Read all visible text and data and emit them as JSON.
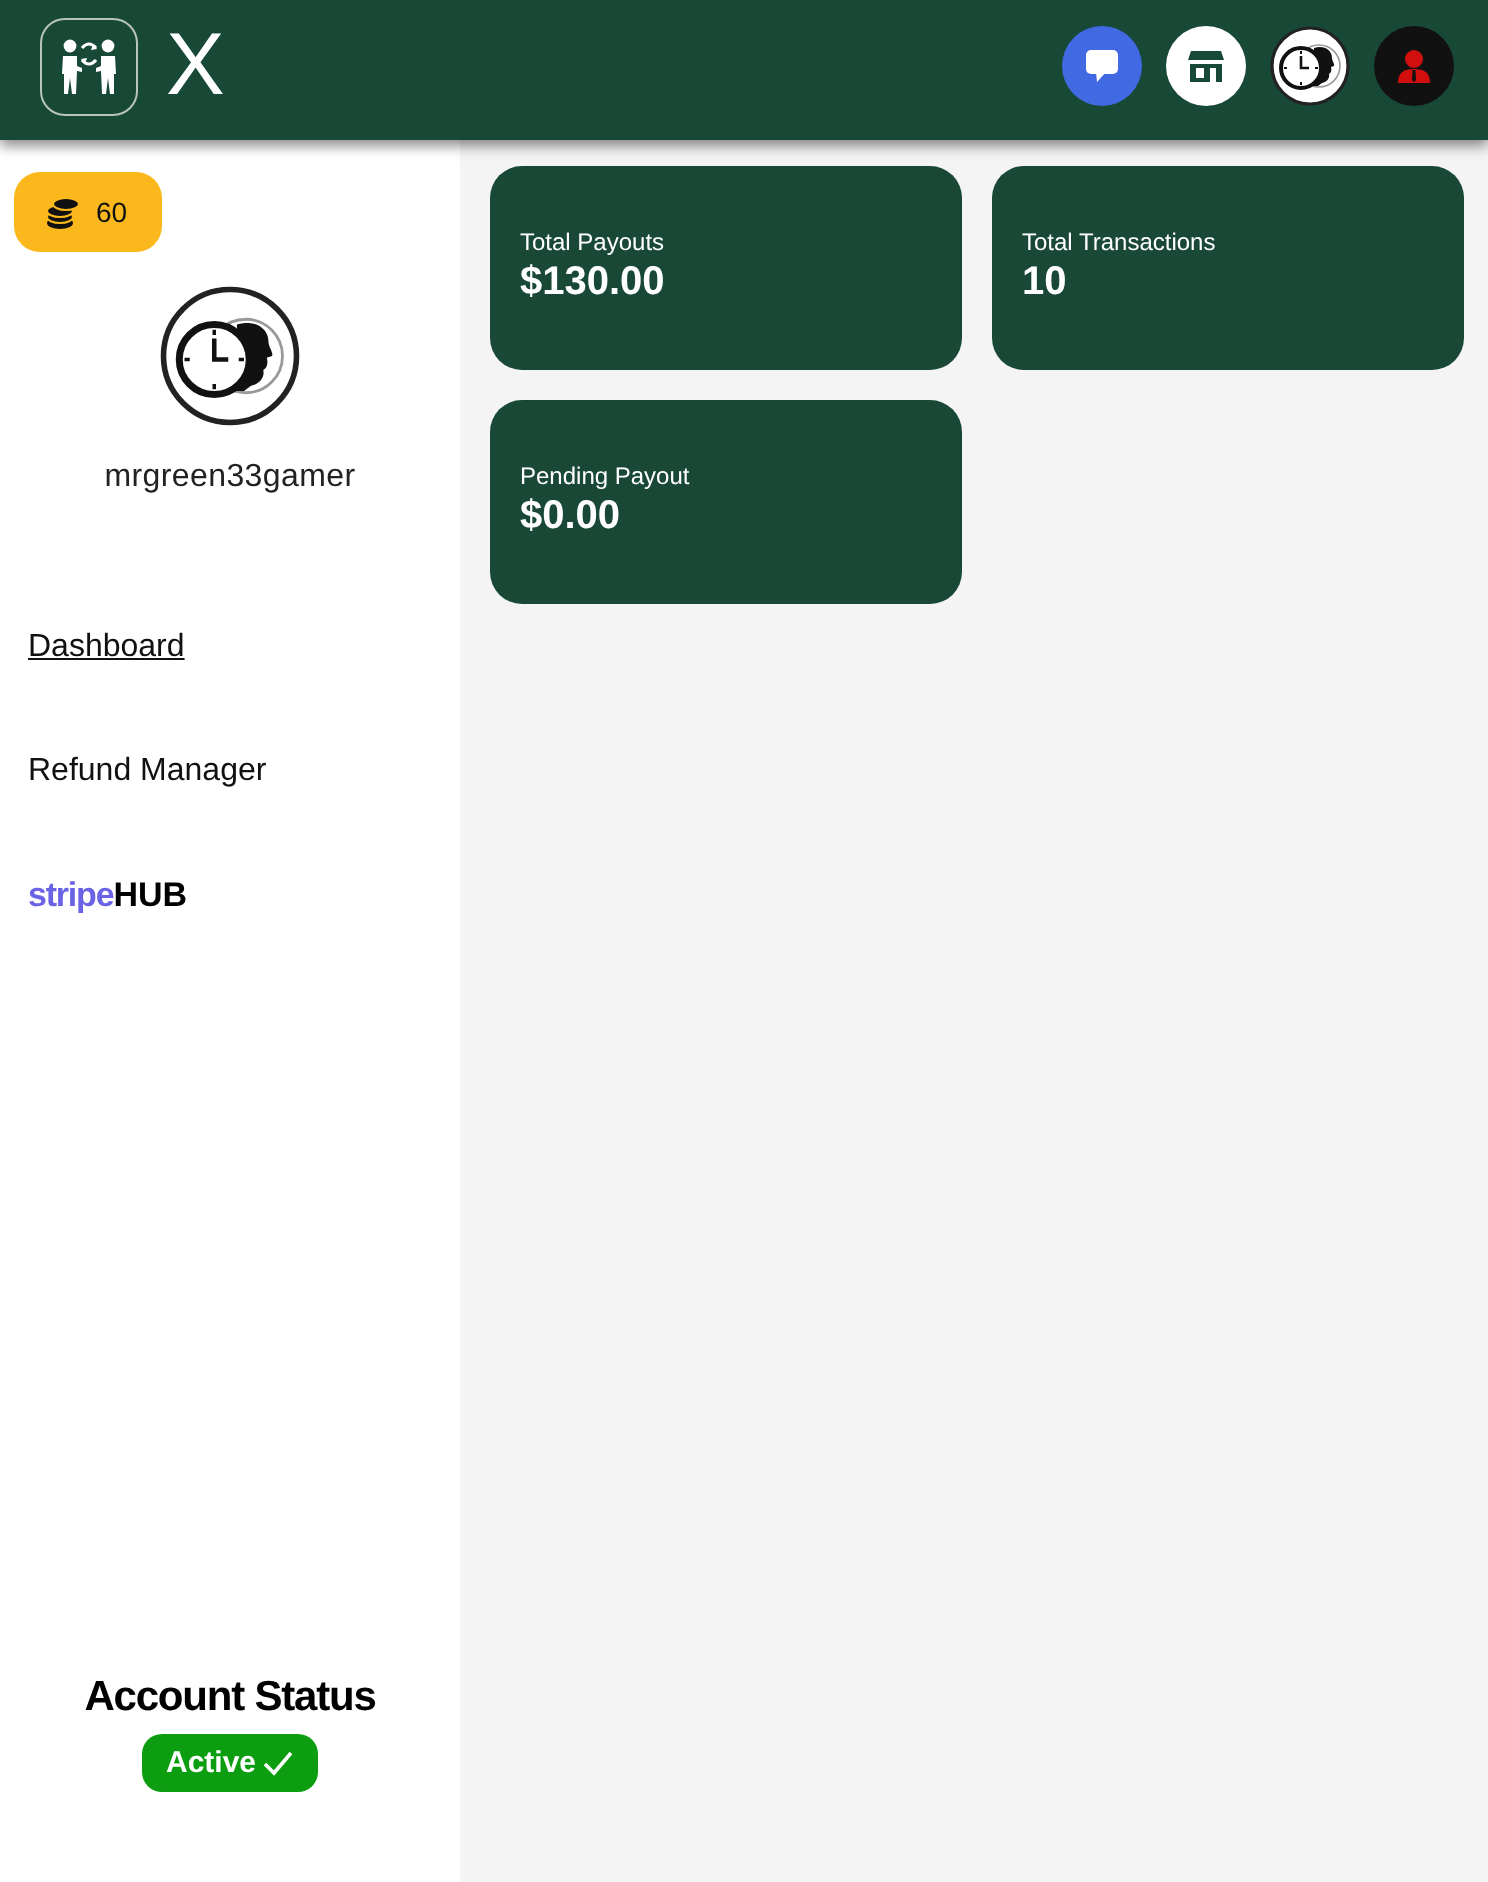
{
  "header": {
    "title": "X",
    "actions": [
      {
        "kind": "chat"
      },
      {
        "kind": "store"
      },
      {
        "kind": "avatar"
      },
      {
        "kind": "profile"
      }
    ]
  },
  "sidebar": {
    "coins": "60",
    "username": "mrgreen33gamer",
    "nav": [
      {
        "kind": "link",
        "label": "Dashboard",
        "selected": true
      },
      {
        "kind": "link",
        "label": "Refund Manager",
        "selected": false
      },
      {
        "kind": "brand",
        "label": "stripe",
        "suffix": "HUB",
        "selected": false
      }
    ],
    "status": {
      "title": "Account Status",
      "badge": "Active",
      "active": true
    }
  },
  "stats": [
    {
      "label": "Total Payouts",
      "value": "$130.00"
    },
    {
      "label": "Total Transactions",
      "value": "10"
    },
    {
      "label": "Pending Payout",
      "value": "$0.00"
    }
  ]
}
